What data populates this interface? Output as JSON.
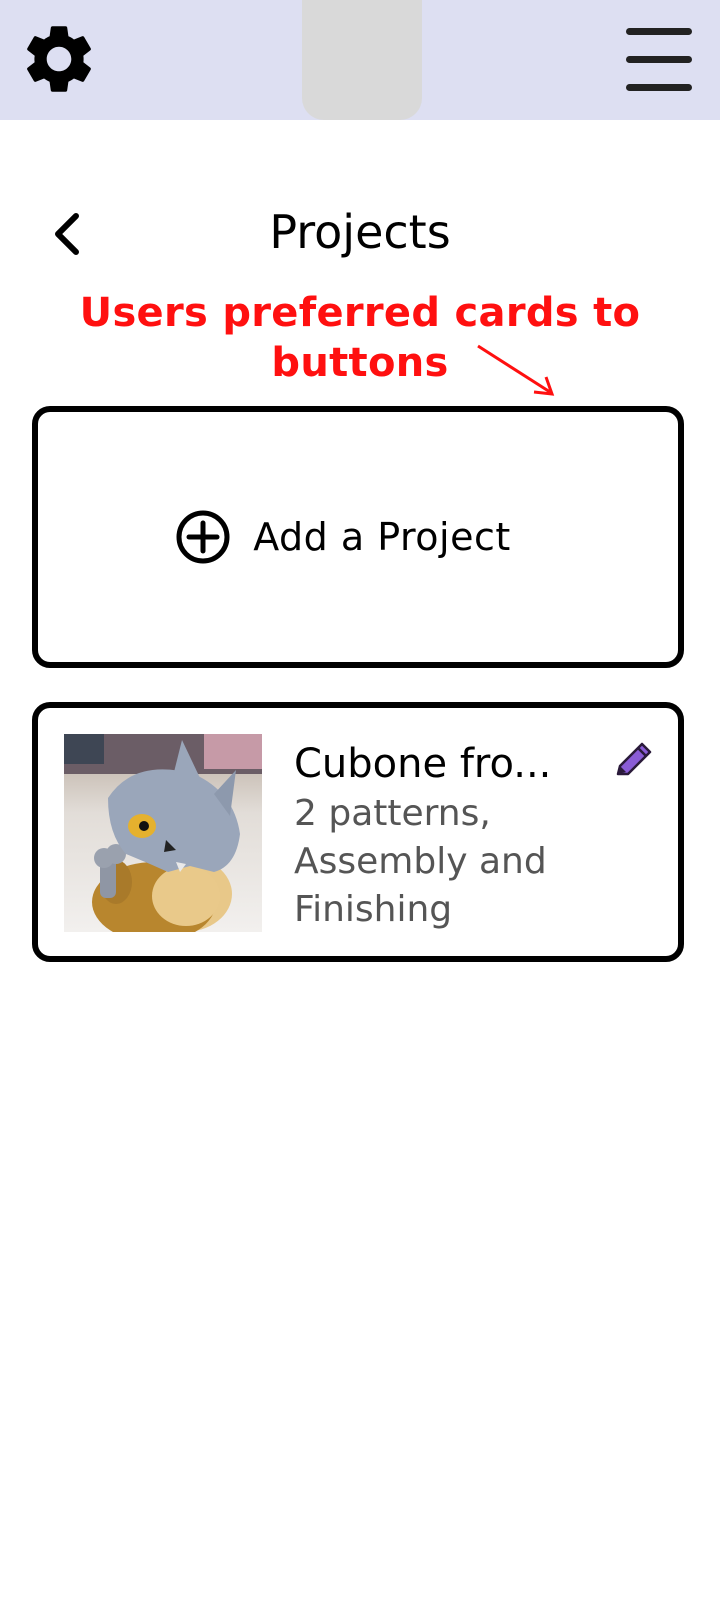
{
  "topbar": {
    "left_icon": "gear-icon",
    "right_icon": "hamburger-menu-icon",
    "background_color": "#dddff2"
  },
  "header": {
    "back_icon": "chevron-left-icon",
    "title": "Projects"
  },
  "annotation": {
    "text": "Users preferred cards to buttons",
    "color": "#ff1010"
  },
  "add_card": {
    "icon": "plus-circle-icon",
    "label": "Add a Project"
  },
  "projects": [
    {
      "name": "Cubone fro...",
      "description": "2 patterns, Assembly and Finishing",
      "edit_icon": "pencil-icon",
      "edit_icon_color": "#8a5cd6"
    }
  ]
}
